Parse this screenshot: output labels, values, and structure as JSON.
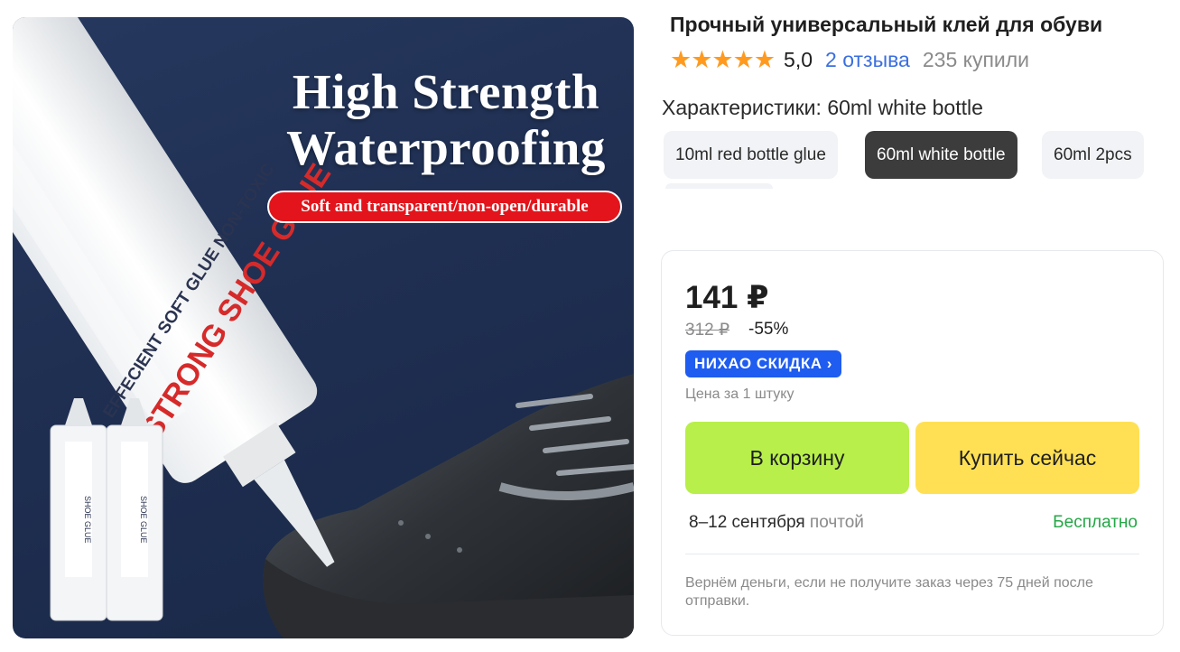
{
  "image": {
    "headline_line1": "High Strength",
    "headline_line2": "Waterproofing",
    "badge": "Soft and transparent/non-open/durable",
    "tube_text_1": "STRONG SHOE GLUE",
    "tube_text_2": "EFFECIENT SOFT GLUE NON-TOXIC",
    "colors": {
      "background": "#223357",
      "badge": "#e3141b"
    }
  },
  "product": {
    "title": "Прочный универсальный клей для обуви",
    "stars": "★★★★★",
    "rating": "5,0",
    "reviews": "2 отзыва",
    "bought": "235 купили"
  },
  "characteristics": {
    "label": "Характеристики: 60ml white bottle",
    "options": [
      {
        "label": "10ml red bottle glue",
        "selected": false
      },
      {
        "label": "60ml white bottle",
        "selected": true
      },
      {
        "label": "60ml 2pcs",
        "selected": false
      }
    ]
  },
  "offer": {
    "price": "141 ₽",
    "old_price": "312 ₽",
    "discount": "-55%",
    "promo_label": "НИХАО СКИДКА",
    "promo_arrow": "›",
    "unit_note": "Цена за 1 штуку",
    "add_to_cart": "В корзину",
    "buy_now": "Купить сейчас",
    "delivery_dates": "8–12 сентября",
    "delivery_method": "почтой",
    "delivery_cost": "Бесплатно",
    "guarantee": "Вернём деньги, если не получите заказ через 75 дней после отправки.",
    "colors": {
      "cart": "#b8ef4a",
      "buy": "#ffe055",
      "promo": "#1f5cf0",
      "free": "#23a745"
    }
  }
}
